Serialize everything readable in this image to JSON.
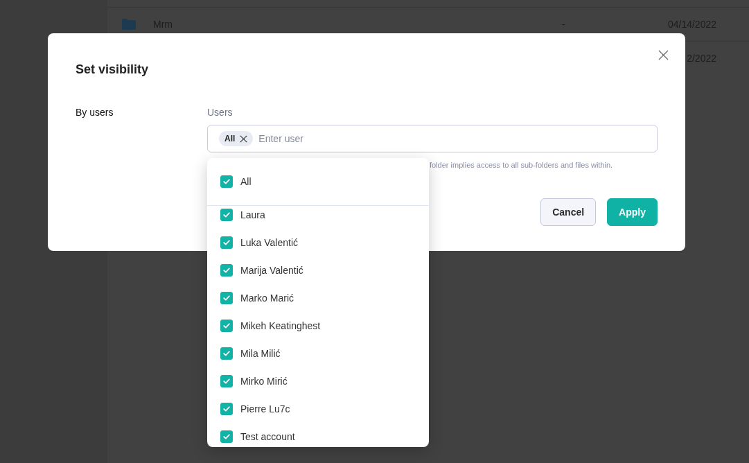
{
  "file_table": {
    "rows": [
      {
        "kind": "folder",
        "column_1": "Mrm",
        "column_2": "-",
        "column_3": "04/14/2022"
      },
      {
        "column_3": "2/2022"
      }
    ]
  },
  "dialog": {
    "title": "Set visibility",
    "section_label": "By users",
    "users_field": {
      "label": "Users",
      "chips": [
        {
          "label": "All"
        }
      ],
      "placeholder": "Enter user",
      "dropdown": {
        "all_option": {
          "label": "All",
          "checked": true
        },
        "options": [
          {
            "label": "Laura",
            "checked": true
          },
          {
            "label": "Luka Valentić",
            "checked": true
          },
          {
            "label": "Marija Valentić",
            "checked": true
          },
          {
            "label": "Marko Marić",
            "checked": true
          },
          {
            "label": "Mikeh Keatinghest",
            "checked": true
          },
          {
            "label": "Mila Milić",
            "checked": true
          },
          {
            "label": "Mirko Mirić",
            "checked": true
          },
          {
            "label": "Pierre Lu7c",
            "checked": true
          },
          {
            "label": "Test account",
            "checked": true
          }
        ]
      }
    },
    "hint": "folder implies access to all sub-folders and files within.",
    "buttons": [
      {
        "label": "Cancel",
        "kind": "secondary"
      },
      {
        "label": "Apply",
        "kind": "primary"
      }
    ]
  }
}
